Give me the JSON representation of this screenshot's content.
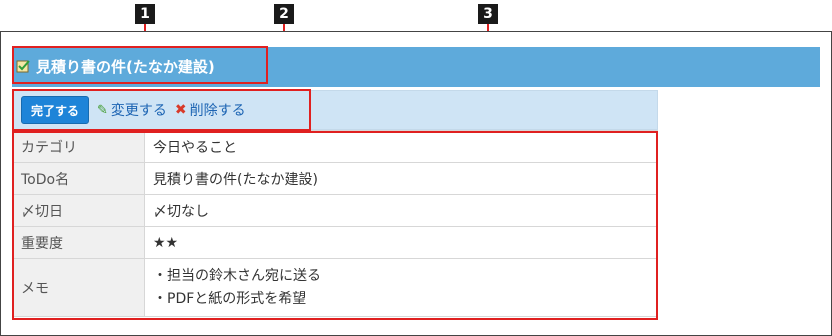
{
  "callouts": [
    "1",
    "2",
    "3"
  ],
  "title": {
    "text": "見積り書の件(たなか建設)",
    "icon": "todo-check-icon"
  },
  "actions": {
    "complete_label": "完了する",
    "edit_label": "変更する",
    "edit_icon": "pencil-icon",
    "delete_label": "削除する",
    "delete_icon": "x-icon"
  },
  "details": [
    {
      "label": "カテゴリ",
      "value": "今日やること"
    },
    {
      "label": "ToDo名",
      "value": "見積り書の件(たなか建設)"
    },
    {
      "label": "〆切日",
      "value": "〆切なし"
    },
    {
      "label": "重要度",
      "value": "★★"
    },
    {
      "label": "メモ",
      "lines": [
        "・担当の鈴木さん宛に送る",
        "・PDFと紙の形式を希望"
      ]
    }
  ],
  "colors": {
    "title_bar": "#5eaadb",
    "action_bar": "#cfe4f5",
    "complete_button": "#1e84d8",
    "link": "#1c64b3",
    "highlight": "#e02020",
    "callout_marker": "#1a1a1a"
  }
}
